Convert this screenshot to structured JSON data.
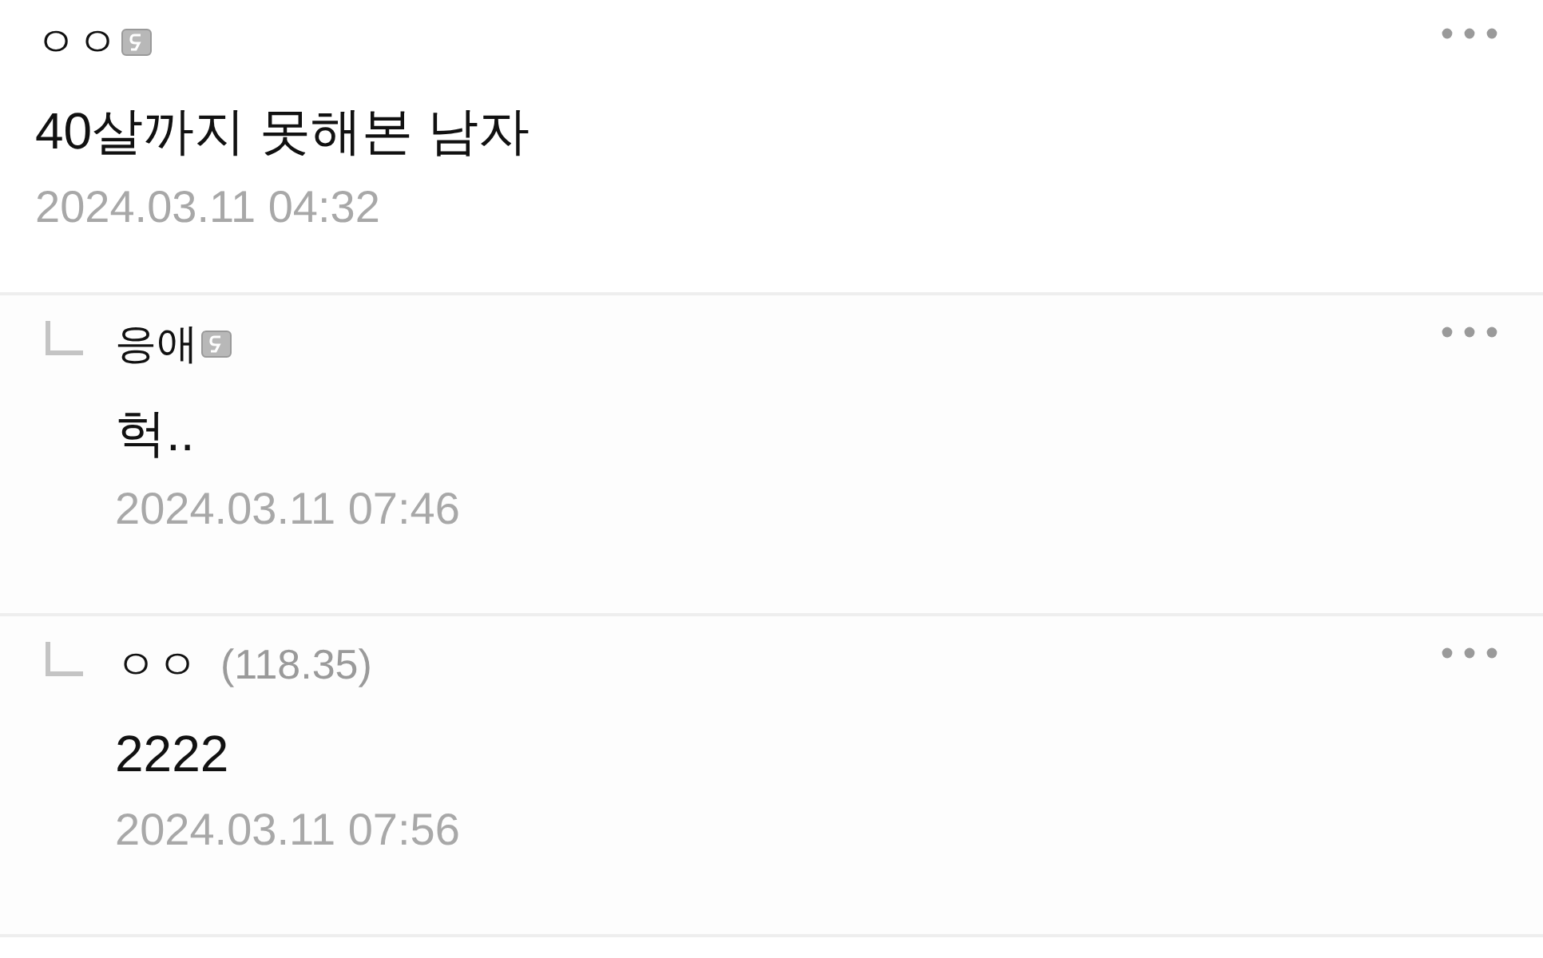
{
  "comments": [
    {
      "kind": "comment",
      "author": "ㅇㅇ",
      "member_badge": true,
      "text": "40살까지 못해본 남자",
      "date": "2024.03.11 04:32"
    },
    {
      "kind": "reply",
      "author": "응애",
      "member_badge": true,
      "text": "헉..",
      "date": "2024.03.11 07:46"
    },
    {
      "kind": "reply",
      "author": "ㅇㅇ",
      "ip": "(118.35)",
      "member_badge": false,
      "text": "2222",
      "date": "2024.03.11 07:56"
    }
  ]
}
